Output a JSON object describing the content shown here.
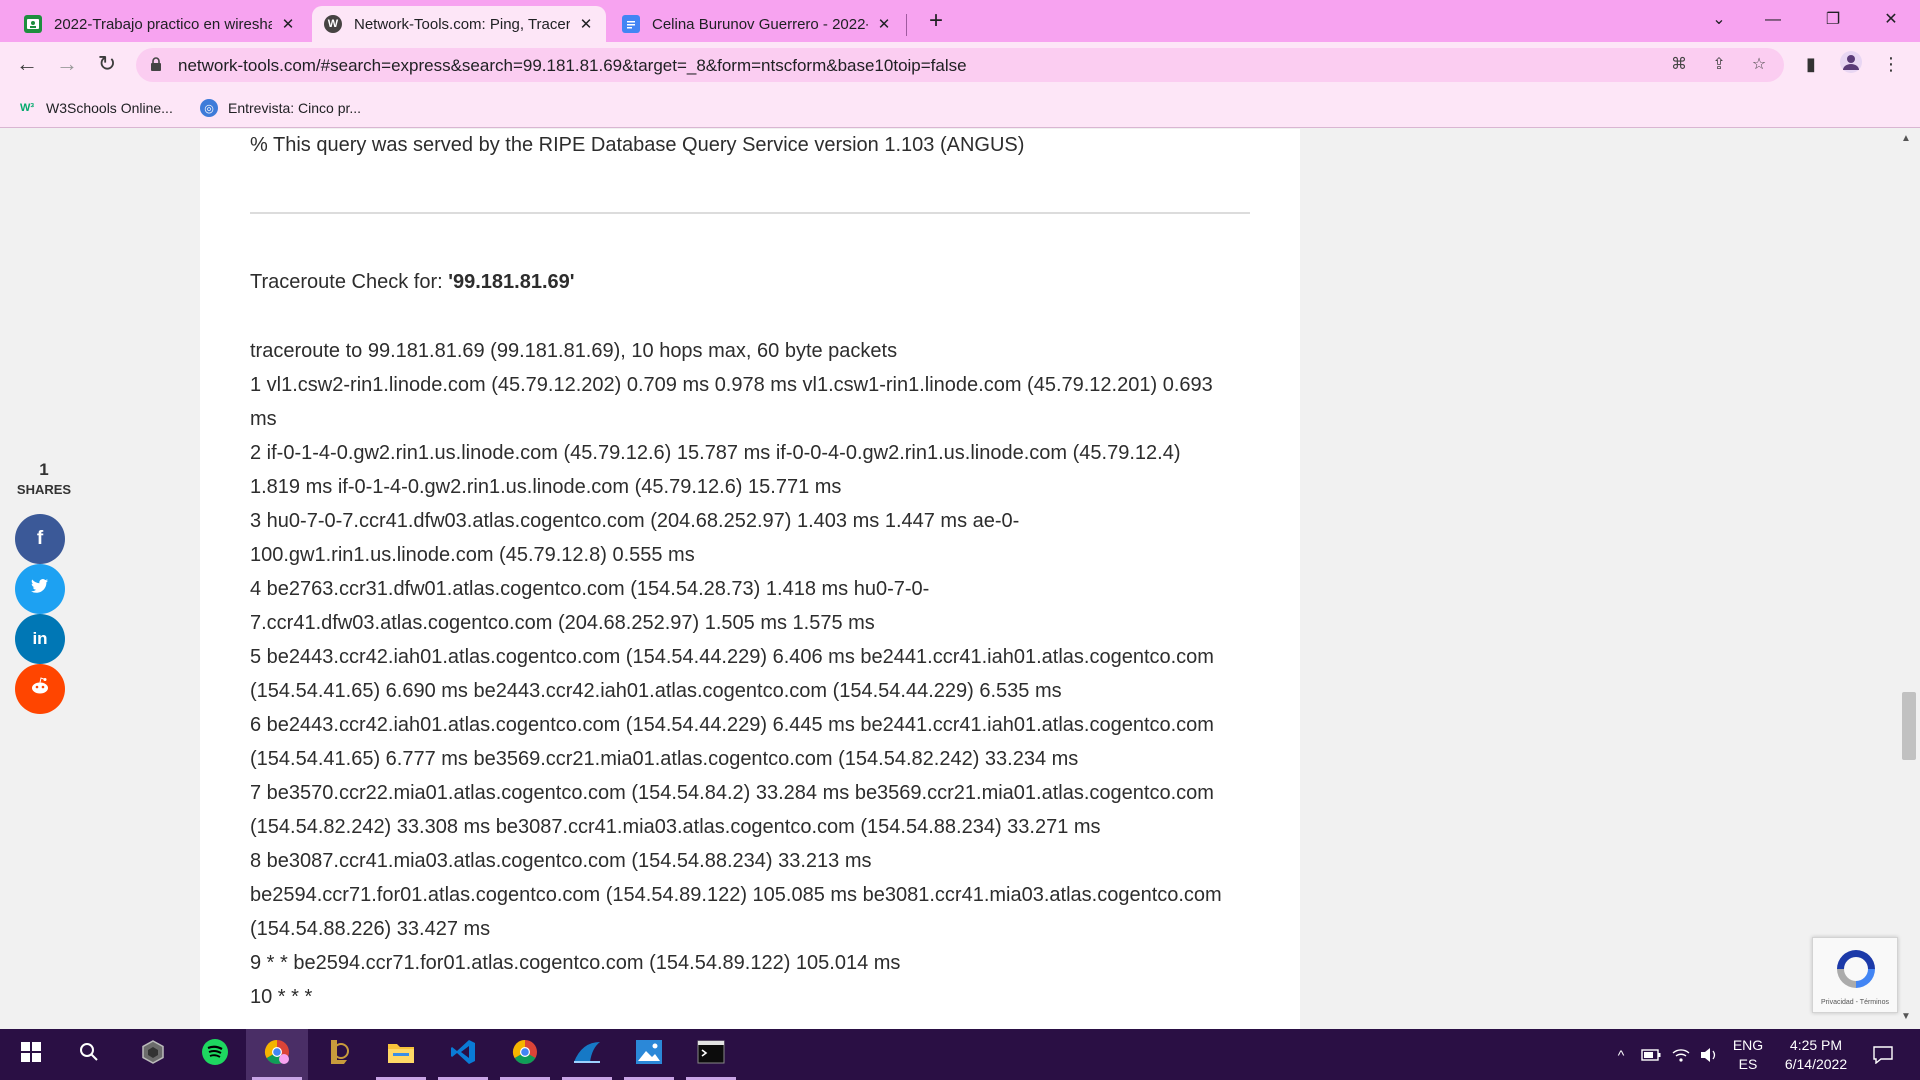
{
  "tabs": [
    {
      "title": "2022-Trabajo practico en wiresha",
      "icon": "classroom-icon",
      "close": "✕"
    },
    {
      "title": "Network-Tools.com: Ping, Tracero",
      "icon": "wordpress-icon",
      "close": "✕"
    },
    {
      "title": "Celina Burunov Guerrero - 2022-",
      "icon": "google-docs-icon",
      "close": "✕"
    }
  ],
  "address_bar": {
    "url": "network-tools.com/#search=express&search=99.181.81.69&target=_8&form=ntscform&base10toip=false"
  },
  "bookmarks": [
    {
      "label": "W3Schools Online...",
      "icon": "w3schools-icon"
    },
    {
      "label": "Entrevista: Cinco pr...",
      "icon": "site-icon"
    }
  ],
  "page": {
    "ripe_line": "% This query was served by the RIPE Database Query Service version 1.103 (ANGUS)",
    "traceroute_heading_prefix": "Traceroute Check for: ",
    "traceroute_target": "'99.181.81.69'",
    "trace_lines": [
      "traceroute to 99.181.81.69 (99.181.81.69), 10 hops max, 60 byte packets",
      "1 vl1.csw2-rin1.linode.com (45.79.12.202) 0.709 ms 0.978 ms vl1.csw1-rin1.linode.com (45.79.12.201) 0.693",
      "ms",
      "2 if-0-1-4-0.gw2.rin1.us.linode.com (45.79.12.6) 15.787 ms if-0-0-4-0.gw2.rin1.us.linode.com (45.79.12.4)",
      "1.819 ms if-0-1-4-0.gw2.rin1.us.linode.com (45.79.12.6) 15.771 ms",
      "3 hu0-7-0-7.ccr41.dfw03.atlas.cogentco.com (204.68.252.97) 1.403 ms 1.447 ms ae-0-",
      "100.gw1.rin1.us.linode.com (45.79.12.8) 0.555 ms",
      "4 be2763.ccr31.dfw01.atlas.cogentco.com (154.54.28.73) 1.418 ms hu0-7-0-",
      "7.ccr41.dfw03.atlas.cogentco.com (204.68.252.97) 1.505 ms 1.575 ms",
      "5 be2443.ccr42.iah01.atlas.cogentco.com (154.54.44.229) 6.406 ms be2441.ccr41.iah01.atlas.cogentco.com",
      "(154.54.41.65) 6.690 ms be2443.ccr42.iah01.atlas.cogentco.com (154.54.44.229) 6.535 ms",
      "6 be2443.ccr42.iah01.atlas.cogentco.com (154.54.44.229) 6.445 ms be2441.ccr41.iah01.atlas.cogentco.com",
      "(154.54.41.65) 6.777 ms be3569.ccr21.mia01.atlas.cogentco.com (154.54.82.242) 33.234 ms",
      "7 be3570.ccr22.mia01.atlas.cogentco.com (154.54.84.2) 33.284 ms be3569.ccr21.mia01.atlas.cogentco.com",
      "(154.54.82.242) 33.308 ms be3087.ccr41.mia03.atlas.cogentco.com (154.54.88.234) 33.271 ms",
      "8 be3087.ccr41.mia03.atlas.cogentco.com (154.54.88.234) 33.213 ms",
      "be2594.ccr71.for01.atlas.cogentco.com (154.54.89.122) 105.085 ms be3081.ccr41.mia03.atlas.cogentco.com",
      "(154.54.88.226) 33.427 ms",
      "9 * * be2594.ccr71.for01.atlas.cogentco.com (154.54.89.122) 105.014 ms",
      "10 * * *"
    ]
  },
  "share": {
    "count": "1",
    "label": "SHARES",
    "buttons": [
      {
        "glyph": "f",
        "color": "#3b5998",
        "icon": "facebook-icon"
      },
      {
        "glyph": "🐦",
        "color": "#1da1f2",
        "icon": "twitter-icon"
      },
      {
        "glyph": "in",
        "color": "#0077b5",
        "icon": "linkedin-icon"
      },
      {
        "glyph": "◉",
        "color": "#ff4500",
        "icon": "reddit-icon"
      }
    ]
  },
  "recaptcha": {
    "label": "Privacidad - Términos"
  },
  "taskbar": {
    "apps": [
      "start-icon",
      "search-icon",
      "app-icon",
      "spotify-icon",
      "chrome-profile-icon",
      "league-icon",
      "file-explorer-icon",
      "vscode-icon",
      "chrome-icon",
      "edge-app-icon",
      "photos-icon",
      "terminal-icon"
    ],
    "lang_top": "ENG",
    "lang_bottom": "ES",
    "time": "4:25 PM",
    "date": "6/14/2022"
  },
  "colors": {
    "tabbar": "#f7a3f0",
    "toolbar": "#fde6f7",
    "taskbar": "#2a0f44"
  }
}
